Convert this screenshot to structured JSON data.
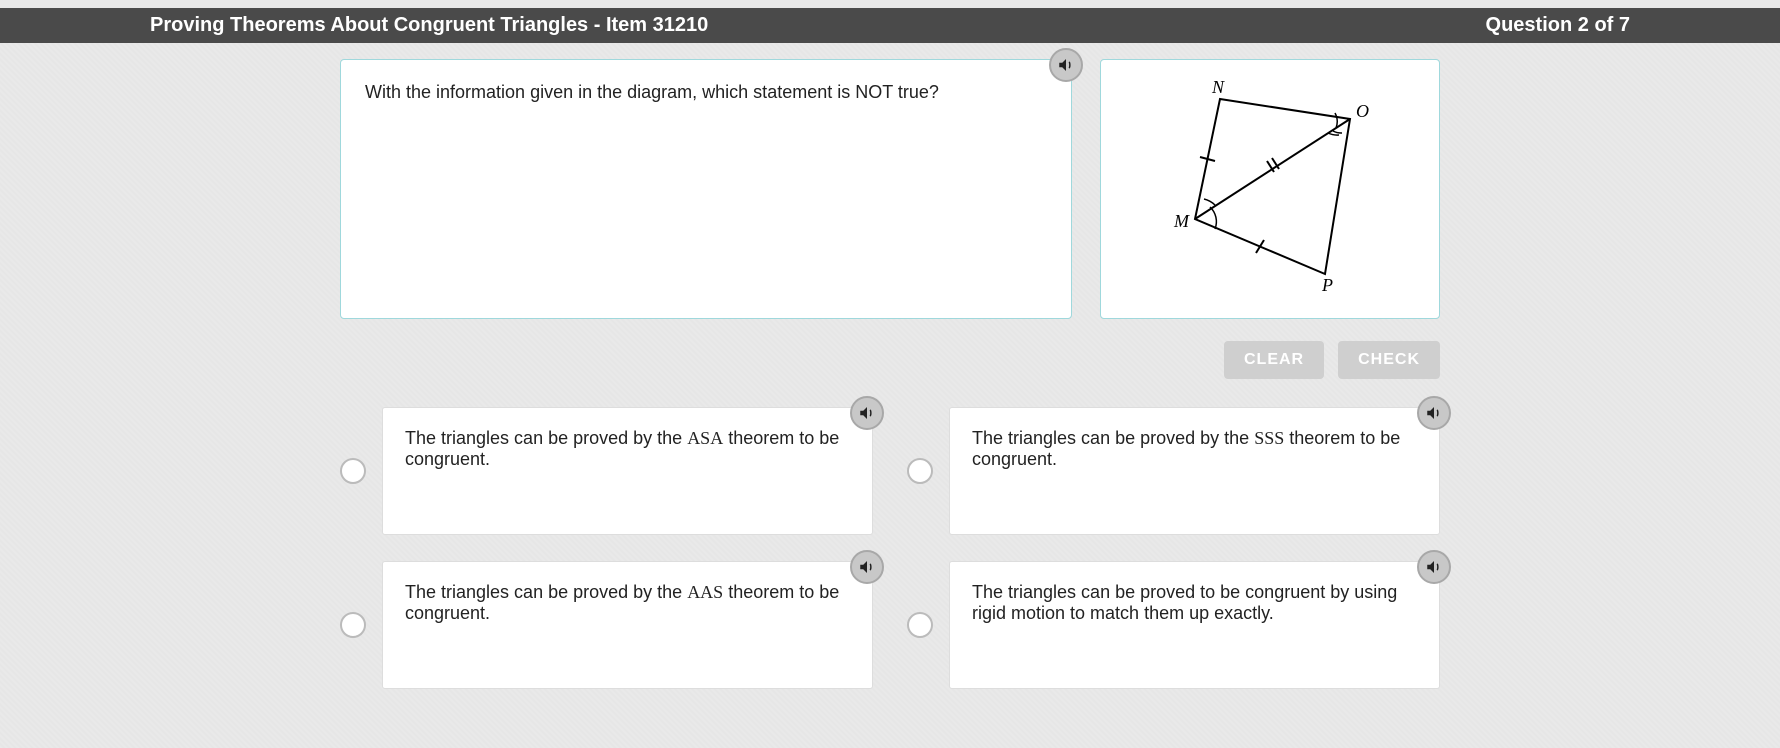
{
  "header": {
    "title": "Proving Theorems About Congruent Triangles - Item 31210",
    "progress": "Question 2 of 7"
  },
  "question": {
    "text": "With the information given in the diagram, which statement is NOT true?"
  },
  "diagram": {
    "vertices": {
      "N": "N",
      "O": "O",
      "M": "M",
      "P": "P"
    }
  },
  "buttons": {
    "clear": "CLEAR",
    "check": "CHECK"
  },
  "answers": {
    "a": {
      "pre": "The triangles can be proved by the ",
      "theorem": "ASA",
      "post": " theorem to be congruent."
    },
    "b": {
      "pre": "The triangles can be proved by the ",
      "theorem": "SSS",
      "post": " theorem to be congruent."
    },
    "c": {
      "pre": "The triangles can be proved by the ",
      "theorem": "AAS",
      "post": " theorem to be congruent."
    },
    "d": {
      "text": "The triangles can be proved to be congruent by using rigid motion to match them up exactly."
    }
  },
  "icons": {
    "speaker": "speaker-icon"
  }
}
